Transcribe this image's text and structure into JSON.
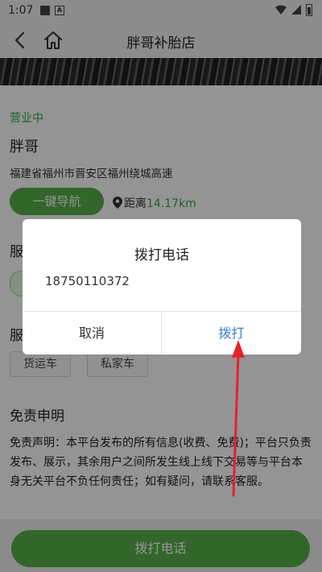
{
  "status_bar": {
    "time": "1:07",
    "icons": [
      "image-icon",
      "a-badge-icon",
      "wifi-icon",
      "signal-icon",
      "battery-icon"
    ]
  },
  "navbar": {
    "title": "胖哥补胎店",
    "back_icon": "chevron-left-icon",
    "home_icon": "home-icon"
  },
  "shop": {
    "status": "营业中",
    "name": "胖哥",
    "address": "福建省福州市晋安区福州绕城高速",
    "navigate_label": "一键导航",
    "distance_label": "距离",
    "distance_value": "14.17km"
  },
  "sections": {
    "section1_label": "服",
    "section2_label": "服",
    "vehicle_tags": [
      "货运车",
      "私家车"
    ]
  },
  "disclaimer": {
    "title": "免责申明",
    "body": "免责声明：本平台发布的所有信息(收费、免费)；平台只负责发布、展示，其余用户之间所发生线上线下交易等与平台本身无关平台不负任何责任；如有疑问，请联系客服。"
  },
  "bottom": {
    "call_label": "拨打电话"
  },
  "dialog": {
    "title": "拨打电话",
    "phone": "18750110372",
    "cancel_label": "取消",
    "confirm_label": "拨打"
  },
  "colors": {
    "accent_green": "#56b049",
    "status_green": "#3aa54a",
    "confirm_blue": "#3a7fd6",
    "annotation_red": "#e8202a"
  }
}
